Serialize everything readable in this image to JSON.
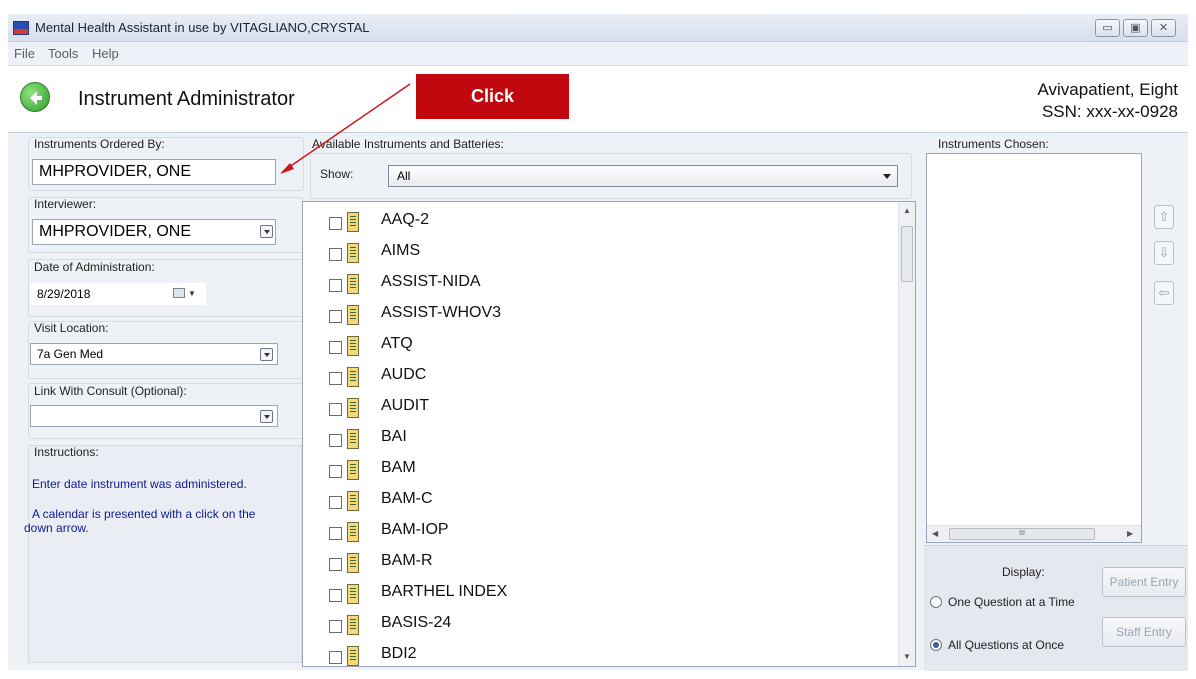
{
  "window": {
    "title": "Mental Health Assistant in use by VITAGLIANO,CRYSTAL",
    "minimize": "▭",
    "maximize": "▣",
    "close": "✕"
  },
  "menu": [
    "File",
    "Tools",
    "Help"
  ],
  "header": {
    "title": "Instrument Administrator",
    "callout": "Click",
    "patient_name": "Avivapatient, Eight",
    "patient_ssn": "SSN: xxx-xx-0928"
  },
  "left": {
    "ordered_by_label": "Instruments Ordered By:",
    "ordered_by_value": "MHPROVIDER, ONE",
    "interviewer_label": "Interviewer:",
    "interviewer_value": "MHPROVIDER, ONE",
    "date_label": "Date of Administration:",
    "date_value": "8/29/2018",
    "visit_label": "Visit Location:",
    "visit_value": "7a Gen Med",
    "consult_label": "Link With Consult (Optional):",
    "consult_value": "",
    "instructions_label": "Instructions:",
    "instructions_line1": "Enter date instrument was administered.",
    "instructions_line2": "A calendar is presented with a click on the",
    "instructions_line3": "down arrow."
  },
  "middle": {
    "available_label": "Available Instruments and Batteries:",
    "show_label": "Show:",
    "show_value": "All",
    "instruments": [
      "AAQ-2",
      "AIMS",
      "ASSIST-NIDA",
      "ASSIST-WHOV3",
      "ATQ",
      "AUDC",
      "AUDIT",
      "BAI",
      "BAM",
      "BAM-C",
      "BAM-IOP",
      "BAM-R",
      "BARTHEL INDEX",
      "BASIS-24",
      "BDI2"
    ]
  },
  "right": {
    "chosen_label": "Instruments Chosen:",
    "scroll_thumb_text": "III",
    "move_up": "⇧",
    "move_down": "⇩",
    "move_left": "⇦",
    "display_label": "Display:",
    "option_one": "One Question at a Time",
    "option_all": "All Questions at Once",
    "patient_entry": "Patient Entry",
    "staff_entry": "Staff Entry"
  },
  "colors": {
    "callout": "#c0080e",
    "instructions_text": "#101a8c",
    "back_button": "#3aa632"
  }
}
